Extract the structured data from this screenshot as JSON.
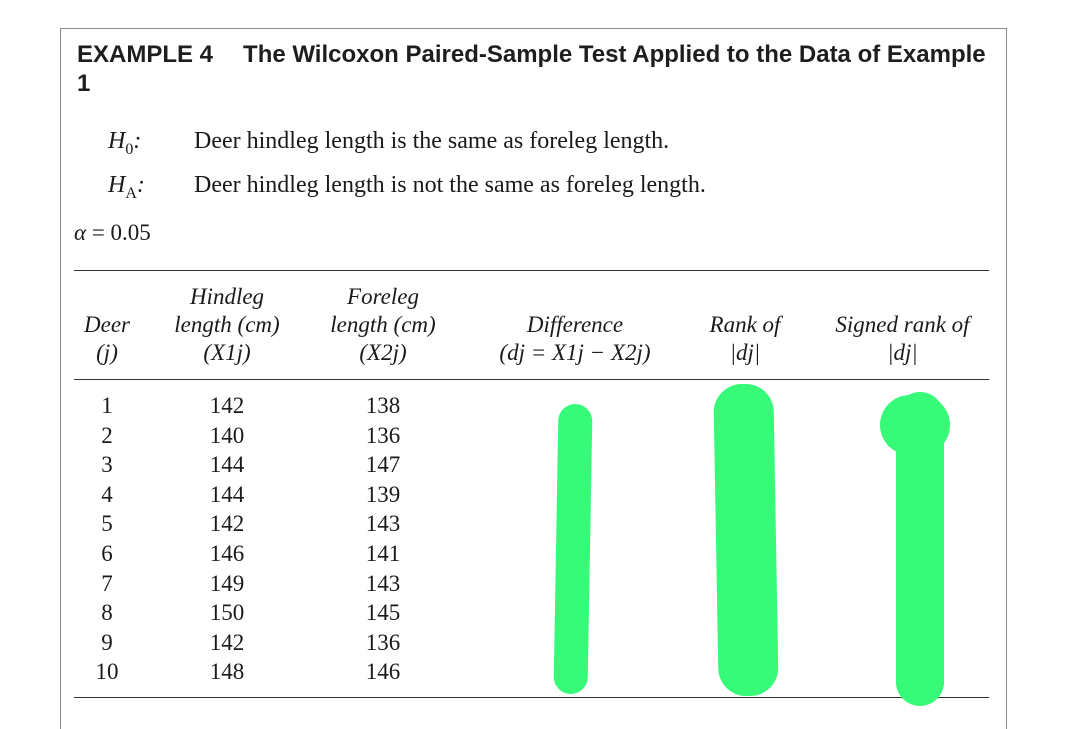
{
  "example": {
    "label": "EXAMPLE 4",
    "title": "The Wilcoxon Paired-Sample Test Applied to the Data of Example 1"
  },
  "hypotheses": {
    "h0_symbol": "H",
    "h0_sub": "0",
    "h0_text": "Deer hindleg length is the same as foreleg length.",
    "ha_symbol": "H",
    "ha_sub": "A",
    "ha_text": "Deer hindleg length is not the same as foreleg length."
  },
  "alpha": {
    "symbol": "α",
    "text": "= 0.05"
  },
  "table": {
    "headers": {
      "deer": [
        "Deer",
        "(j)"
      ],
      "hindleg": [
        "Hindleg",
        "length (cm)",
        "(X1j)"
      ],
      "foreleg": [
        "Foreleg",
        "length (cm)",
        "(X2j)"
      ],
      "difference": [
        "Difference",
        "(dj = X1j − X2j)"
      ],
      "rank": [
        "Rank of",
        "|dj|"
      ],
      "signed_rank": [
        "Signed rank of",
        "|dj|"
      ]
    },
    "rows": [
      {
        "deer": "1",
        "hindleg": "142",
        "foreleg": "138"
      },
      {
        "deer": "2",
        "hindleg": "140",
        "foreleg": "136"
      },
      {
        "deer": "3",
        "hindleg": "144",
        "foreleg": "147"
      },
      {
        "deer": "4",
        "hindleg": "144",
        "foreleg": "139"
      },
      {
        "deer": "5",
        "hindleg": "142",
        "foreleg": "143"
      },
      {
        "deer": "6",
        "hindleg": "146",
        "foreleg": "141"
      },
      {
        "deer": "7",
        "hindleg": "149",
        "foreleg": "143"
      },
      {
        "deer": "8",
        "hindleg": "150",
        "foreleg": "145"
      },
      {
        "deer": "9",
        "hindleg": "142",
        "foreleg": "136"
      },
      {
        "deer": "10",
        "hindleg": "148",
        "foreleg": "146"
      }
    ]
  },
  "colors": {
    "highlighter": "#37fb78",
    "text": "#1a1a1a",
    "rule": "#333333"
  }
}
